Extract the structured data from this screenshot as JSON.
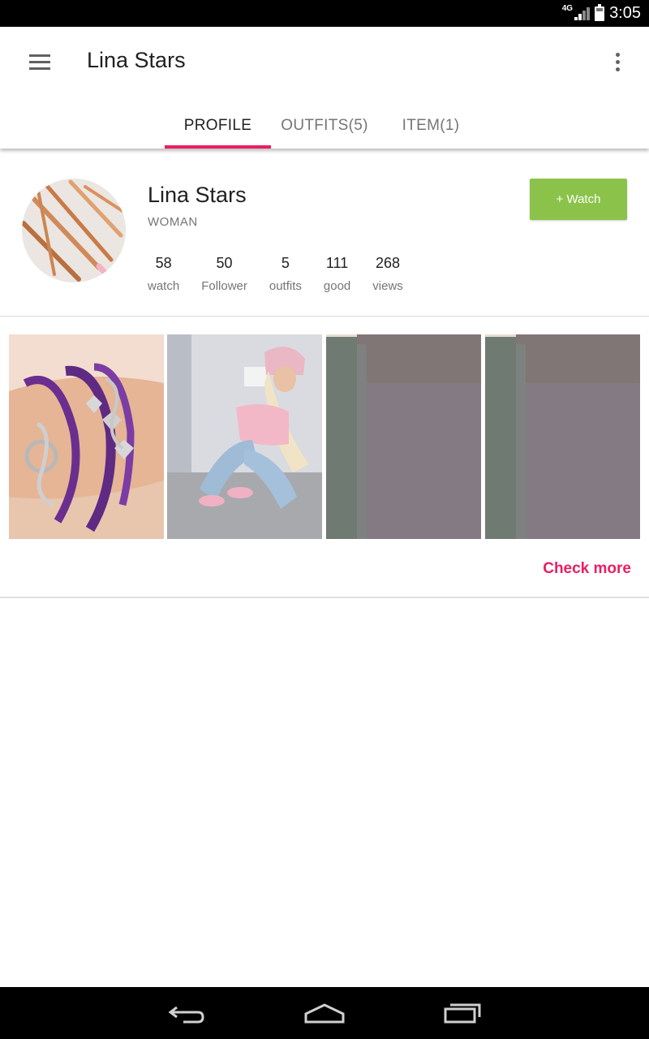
{
  "status_bar": {
    "network": "4G",
    "time": "3:05"
  },
  "app_bar": {
    "title": "Lina Stars",
    "tabs": [
      {
        "label": "PROFILE",
        "active": true
      },
      {
        "label": "OUTFITS(5)",
        "active": false
      },
      {
        "label": "ITEM(1)",
        "active": false
      }
    ]
  },
  "profile": {
    "name": "Lina Stars",
    "gender": "WOMAN",
    "watch_button": "+ Watch",
    "stats": [
      {
        "value": "58",
        "label": "watch"
      },
      {
        "value": "50",
        "label": "Follower"
      },
      {
        "value": "5",
        "label": "outfits"
      },
      {
        "value": "111",
        "label": "good"
      },
      {
        "value": "268",
        "label": "views"
      }
    ]
  },
  "gallery": {
    "check_more": "Check more"
  },
  "colors": {
    "accent": "#e91e63",
    "watch_green": "#8bc34a",
    "status_bar": "#000000"
  },
  "icons": [
    "menu-icon",
    "more-vert-icon",
    "back-icon",
    "home-icon",
    "recent-apps-icon",
    "signal-icon",
    "battery-icon"
  ]
}
